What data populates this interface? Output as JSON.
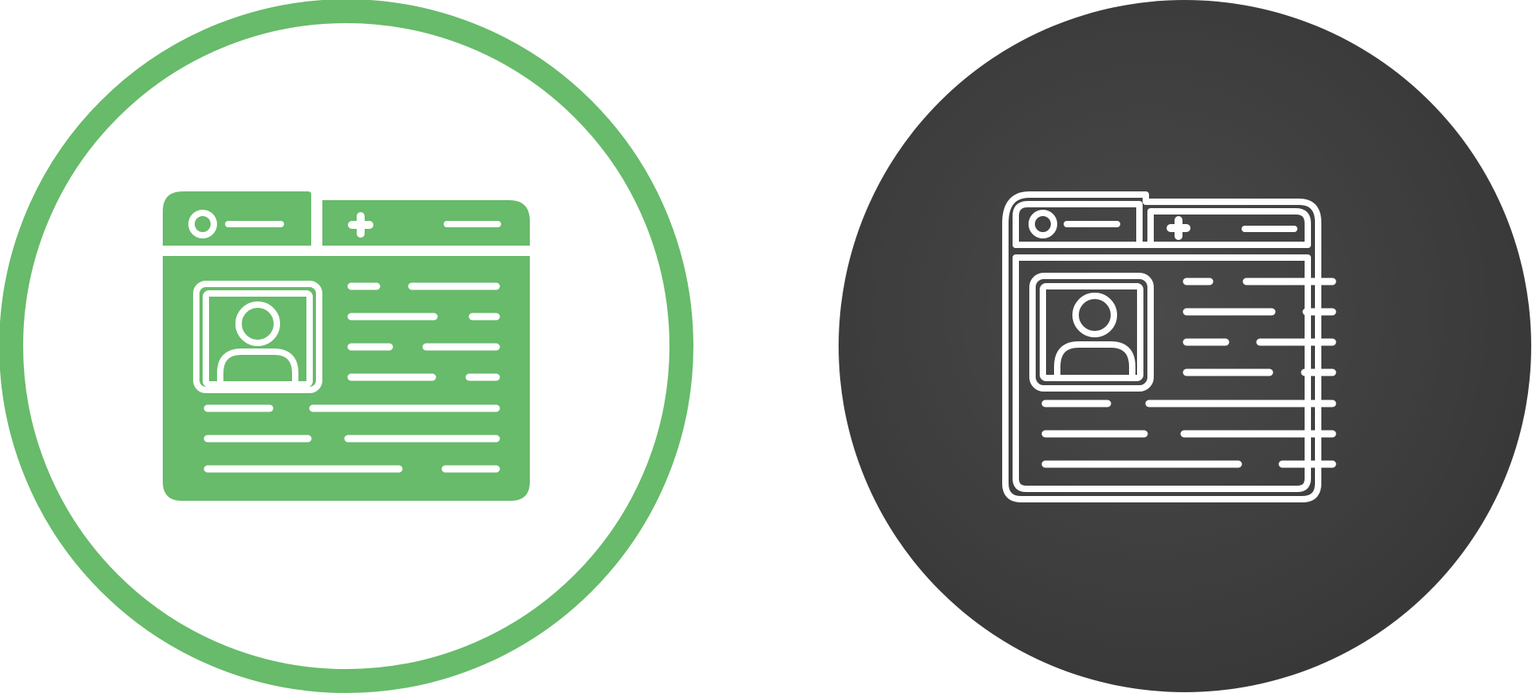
{
  "icons": [
    {
      "name": "profile-browser-icon-green",
      "style": "filled",
      "ring_color": "#67bb6a",
      "fill_color": "#67bb6a",
      "line_color": "#ffffff",
      "background": "#ffffff"
    },
    {
      "name": "profile-browser-icon-dark",
      "style": "outline",
      "disc_color": "#404040",
      "line_color": "#ffffff"
    }
  ]
}
